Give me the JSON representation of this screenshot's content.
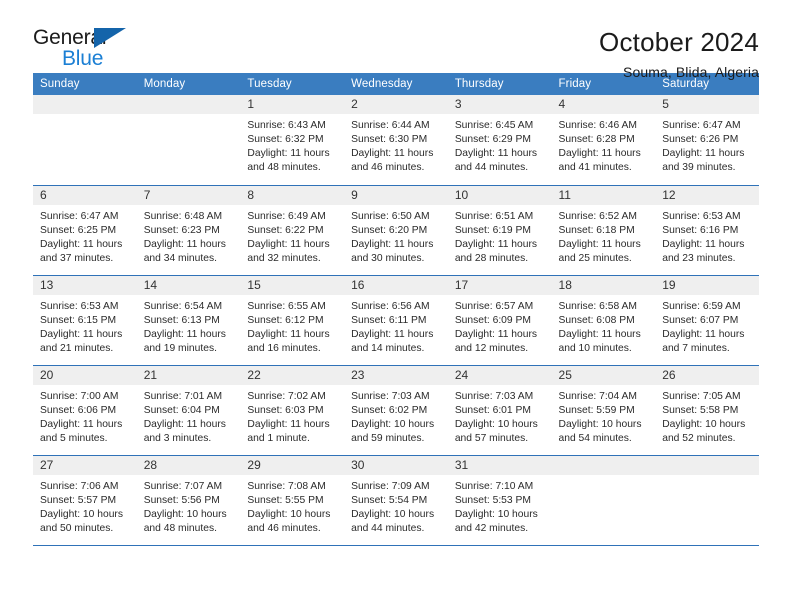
{
  "brand": {
    "name_part1": "General",
    "name_part2": "Blue",
    "triangle_color": "#1464aa",
    "blue_color": "#1b7fd4"
  },
  "header": {
    "title": "October 2024",
    "subtitle": "Souma, Blida, Algeria"
  },
  "calendar": {
    "header_bg": "#3a7dc0",
    "daynum_bg": "#efefef",
    "row_divider_color": "#2f72b8",
    "weekday_headers": [
      "Sunday",
      "Monday",
      "Tuesday",
      "Wednesday",
      "Thursday",
      "Friday",
      "Saturday"
    ],
    "weeks": [
      [
        {
          "day": "",
          "sunrise": "",
          "sunset": "",
          "daylight": ""
        },
        {
          "day": "",
          "sunrise": "",
          "sunset": "",
          "daylight": ""
        },
        {
          "day": "1",
          "sunrise": "Sunrise: 6:43 AM",
          "sunset": "Sunset: 6:32 PM",
          "daylight": "Daylight: 11 hours and 48 minutes."
        },
        {
          "day": "2",
          "sunrise": "Sunrise: 6:44 AM",
          "sunset": "Sunset: 6:30 PM",
          "daylight": "Daylight: 11 hours and 46 minutes."
        },
        {
          "day": "3",
          "sunrise": "Sunrise: 6:45 AM",
          "sunset": "Sunset: 6:29 PM",
          "daylight": "Daylight: 11 hours and 44 minutes."
        },
        {
          "day": "4",
          "sunrise": "Sunrise: 6:46 AM",
          "sunset": "Sunset: 6:28 PM",
          "daylight": "Daylight: 11 hours and 41 minutes."
        },
        {
          "day": "5",
          "sunrise": "Sunrise: 6:47 AM",
          "sunset": "Sunset: 6:26 PM",
          "daylight": "Daylight: 11 hours and 39 minutes."
        }
      ],
      [
        {
          "day": "6",
          "sunrise": "Sunrise: 6:47 AM",
          "sunset": "Sunset: 6:25 PM",
          "daylight": "Daylight: 11 hours and 37 minutes."
        },
        {
          "day": "7",
          "sunrise": "Sunrise: 6:48 AM",
          "sunset": "Sunset: 6:23 PM",
          "daylight": "Daylight: 11 hours and 34 minutes."
        },
        {
          "day": "8",
          "sunrise": "Sunrise: 6:49 AM",
          "sunset": "Sunset: 6:22 PM",
          "daylight": "Daylight: 11 hours and 32 minutes."
        },
        {
          "day": "9",
          "sunrise": "Sunrise: 6:50 AM",
          "sunset": "Sunset: 6:20 PM",
          "daylight": "Daylight: 11 hours and 30 minutes."
        },
        {
          "day": "10",
          "sunrise": "Sunrise: 6:51 AM",
          "sunset": "Sunset: 6:19 PM",
          "daylight": "Daylight: 11 hours and 28 minutes."
        },
        {
          "day": "11",
          "sunrise": "Sunrise: 6:52 AM",
          "sunset": "Sunset: 6:18 PM",
          "daylight": "Daylight: 11 hours and 25 minutes."
        },
        {
          "day": "12",
          "sunrise": "Sunrise: 6:53 AM",
          "sunset": "Sunset: 6:16 PM",
          "daylight": "Daylight: 11 hours and 23 minutes."
        }
      ],
      [
        {
          "day": "13",
          "sunrise": "Sunrise: 6:53 AM",
          "sunset": "Sunset: 6:15 PM",
          "daylight": "Daylight: 11 hours and 21 minutes."
        },
        {
          "day": "14",
          "sunrise": "Sunrise: 6:54 AM",
          "sunset": "Sunset: 6:13 PM",
          "daylight": "Daylight: 11 hours and 19 minutes."
        },
        {
          "day": "15",
          "sunrise": "Sunrise: 6:55 AM",
          "sunset": "Sunset: 6:12 PM",
          "daylight": "Daylight: 11 hours and 16 minutes."
        },
        {
          "day": "16",
          "sunrise": "Sunrise: 6:56 AM",
          "sunset": "Sunset: 6:11 PM",
          "daylight": "Daylight: 11 hours and 14 minutes."
        },
        {
          "day": "17",
          "sunrise": "Sunrise: 6:57 AM",
          "sunset": "Sunset: 6:09 PM",
          "daylight": "Daylight: 11 hours and 12 minutes."
        },
        {
          "day": "18",
          "sunrise": "Sunrise: 6:58 AM",
          "sunset": "Sunset: 6:08 PM",
          "daylight": "Daylight: 11 hours and 10 minutes."
        },
        {
          "day": "19",
          "sunrise": "Sunrise: 6:59 AM",
          "sunset": "Sunset: 6:07 PM",
          "daylight": "Daylight: 11 hours and 7 minutes."
        }
      ],
      [
        {
          "day": "20",
          "sunrise": "Sunrise: 7:00 AM",
          "sunset": "Sunset: 6:06 PM",
          "daylight": "Daylight: 11 hours and 5 minutes."
        },
        {
          "day": "21",
          "sunrise": "Sunrise: 7:01 AM",
          "sunset": "Sunset: 6:04 PM",
          "daylight": "Daylight: 11 hours and 3 minutes."
        },
        {
          "day": "22",
          "sunrise": "Sunrise: 7:02 AM",
          "sunset": "Sunset: 6:03 PM",
          "daylight": "Daylight: 11 hours and 1 minute."
        },
        {
          "day": "23",
          "sunrise": "Sunrise: 7:03 AM",
          "sunset": "Sunset: 6:02 PM",
          "daylight": "Daylight: 10 hours and 59 minutes."
        },
        {
          "day": "24",
          "sunrise": "Sunrise: 7:03 AM",
          "sunset": "Sunset: 6:01 PM",
          "daylight": "Daylight: 10 hours and 57 minutes."
        },
        {
          "day": "25",
          "sunrise": "Sunrise: 7:04 AM",
          "sunset": "Sunset: 5:59 PM",
          "daylight": "Daylight: 10 hours and 54 minutes."
        },
        {
          "day": "26",
          "sunrise": "Sunrise: 7:05 AM",
          "sunset": "Sunset: 5:58 PM",
          "daylight": "Daylight: 10 hours and 52 minutes."
        }
      ],
      [
        {
          "day": "27",
          "sunrise": "Sunrise: 7:06 AM",
          "sunset": "Sunset: 5:57 PM",
          "daylight": "Daylight: 10 hours and 50 minutes."
        },
        {
          "day": "28",
          "sunrise": "Sunrise: 7:07 AM",
          "sunset": "Sunset: 5:56 PM",
          "daylight": "Daylight: 10 hours and 48 minutes."
        },
        {
          "day": "29",
          "sunrise": "Sunrise: 7:08 AM",
          "sunset": "Sunset: 5:55 PM",
          "daylight": "Daylight: 10 hours and 46 minutes."
        },
        {
          "day": "30",
          "sunrise": "Sunrise: 7:09 AM",
          "sunset": "Sunset: 5:54 PM",
          "daylight": "Daylight: 10 hours and 44 minutes."
        },
        {
          "day": "31",
          "sunrise": "Sunrise: 7:10 AM",
          "sunset": "Sunset: 5:53 PM",
          "daylight": "Daylight: 10 hours and 42 minutes."
        },
        {
          "day": "",
          "sunrise": "",
          "sunset": "",
          "daylight": ""
        },
        {
          "day": "",
          "sunrise": "",
          "sunset": "",
          "daylight": ""
        }
      ]
    ]
  }
}
